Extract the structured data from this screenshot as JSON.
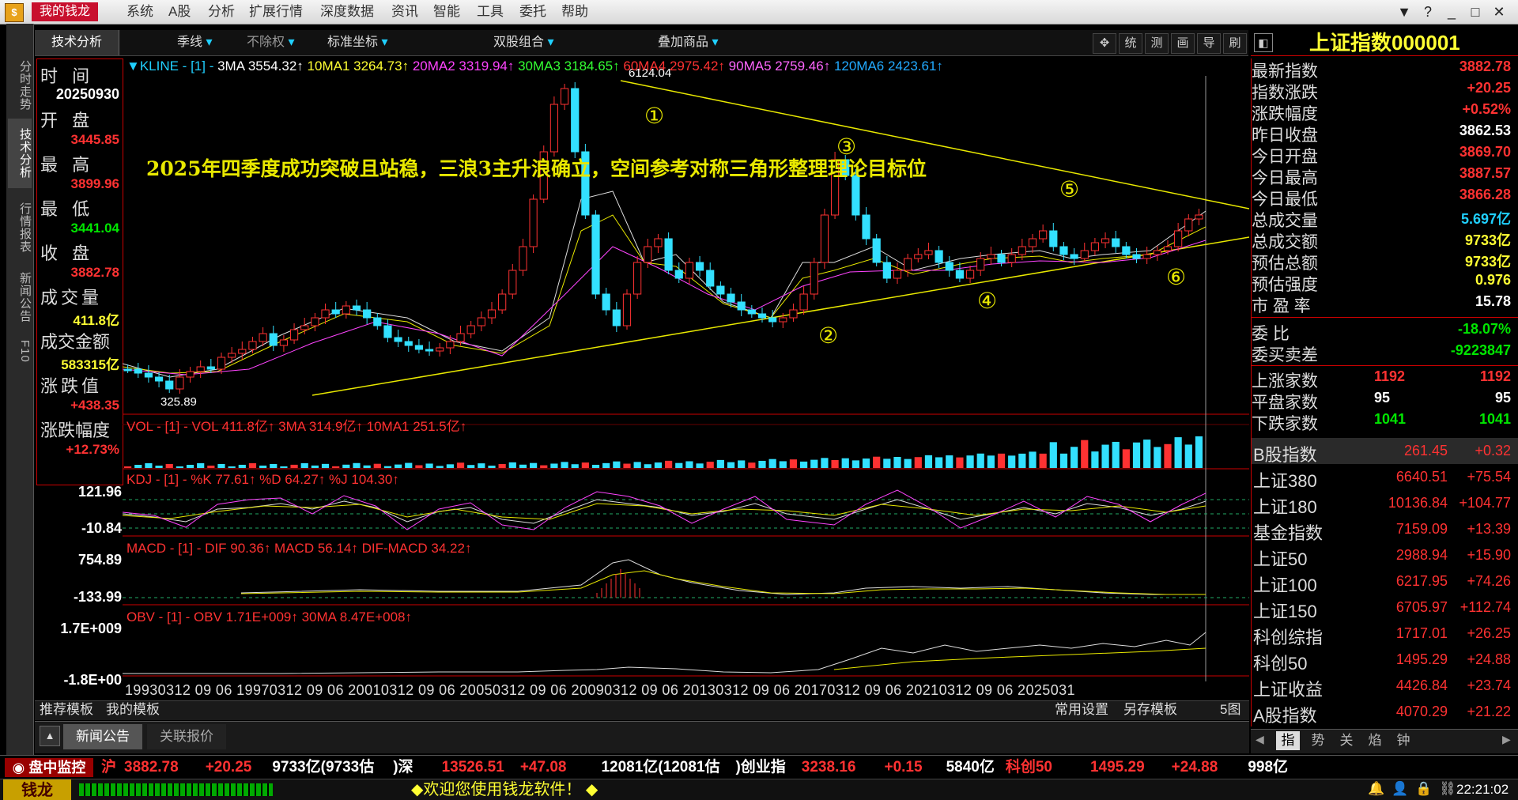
{
  "app": {
    "name": "我的钱龙",
    "menu": [
      "系统",
      "A股",
      "分析",
      "扩展行情",
      "深度数据",
      "资讯",
      "智能",
      "工具",
      "委托",
      "帮助"
    ],
    "window_buttons": [
      "▼",
      "?",
      "_",
      "□",
      "✕"
    ]
  },
  "left_tabs": [
    "分时走势",
    "技术分析",
    "行情报表",
    "新闻公告",
    "F10"
  ],
  "toolbar": {
    "tab_label": "技术分析",
    "period": "季线",
    "fq": "不除权",
    "coord": "标准坐标",
    "combo": "双股组合",
    "overlay": "叠加商品",
    "tool_icons": [
      "统",
      "测",
      "画",
      "导",
      "刷"
    ]
  },
  "info": {
    "time_label": "时  间",
    "time": "20250930",
    "open_label": "开  盘",
    "open": "3445.85",
    "high_label": "最  高",
    "high": "3899.96",
    "low_label": "最  低",
    "low": "3441.04",
    "close_label": "收  盘",
    "close": "3882.78",
    "vol_label": "成交量",
    "vol": "411.8亿",
    "amt_label": "成交金额",
    "amt": "583315亿",
    "chg_label": "涨跌值",
    "chg": "+438.35",
    "pct_label": "涨跌幅度",
    "pct": "+12.73%"
  },
  "chart_legends": {
    "kline": {
      "title": "▼KLINE - [1] -",
      "items": [
        {
          "text": "3MA 3554.32↑",
          "color": "#ffffff"
        },
        {
          "text": "10MA1 3264.73↑",
          "color": "#ffff33"
        },
        {
          "text": "20MA2 3319.94↑",
          "color": "#ff44ff"
        },
        {
          "text": "30MA3 3184.65↑",
          "color": "#33ff33"
        },
        {
          "text": "60MA4 2975.42↑",
          "color": "#ff3232"
        },
        {
          "text": "90MA5 2759.46↑",
          "color": "#ff66ff"
        },
        {
          "text": "120MA6 2423.61↑",
          "color": "#22aaff"
        }
      ]
    },
    "vol": "VOL - [1] - VOL 411.8亿↑ 3MA 314.9亿↑ 10MA1 251.5亿↑",
    "kdj": "KDJ - [1] - %K 77.61↑ %D 64.27↑ %J 104.30↑",
    "macd": "MACD - [1] - DIF 90.36↑ MACD 56.14↑ DIF-MACD 34.22↑",
    "obv": "OBV - [1] - OBV 1.71E+009↑ 30MA 8.47E+008↑"
  },
  "annotation": "2025年四季度成功突破且站稳，三浪3主升浪确立，空间参考对称三角形整理理论目标位",
  "markers": [
    "6124.04",
    "325.89",
    "①",
    "②",
    "③",
    "④",
    "⑤",
    "⑥"
  ],
  "axis_values": {
    "kdj_top": "121.96",
    "kdj_bot": "-10.84",
    "macd_top": "754.89",
    "macd_bot": "-133.99",
    "obv_top": "1.7E+009",
    "obv_bot": "-1.8E+00"
  },
  "x_axis": "19930312 09 06 19970312 09 06 20010312 09 06 20050312 09 06 20090312 09 06 20130312 09 06 20170312 09 06 20210312 09 06 2025031",
  "bottom_tabs": {
    "template_tabs": [
      "推荐模板",
      "我的模板"
    ],
    "right_controls": [
      "常用设置",
      "另存模板",
      "5图"
    ],
    "news_tabs": [
      "新闻公告",
      "关联报价"
    ]
  },
  "right_panel": {
    "title": "上证指数000001",
    "rows": [
      {
        "label": "最新指数",
        "value": "3882.78",
        "color": "#ff3232"
      },
      {
        "label": "指数涨跌",
        "value": "+20.25",
        "color": "#ff3232"
      },
      {
        "label": "涨跌幅度",
        "value": "+0.52%",
        "color": "#ff3232"
      },
      {
        "label": "昨日收盘",
        "value": "3862.53",
        "color": "#ffffff"
      },
      {
        "label": "今日开盘",
        "value": "3869.70",
        "color": "#ff3232"
      },
      {
        "label": "今日最高",
        "value": "3887.57",
        "color": "#ff3232"
      },
      {
        "label": "今日最低",
        "value": "3866.28",
        "color": "#ff3232"
      },
      {
        "label": "总成交量",
        "value": "5.697亿",
        "color": "#20d0ff"
      },
      {
        "label": "总成交额",
        "value": "9733亿",
        "color": "#ffff33"
      },
      {
        "label": "预估总额",
        "value": "9733亿",
        "color": "#ffff33"
      },
      {
        "label": "预估强度",
        "value": "0.976",
        "color": "#ffff33"
      },
      {
        "label": "市 盈 率",
        "value": "15.78",
        "color": "#ffffff"
      }
    ],
    "rows2": [
      {
        "label": "委  比",
        "value": "-18.07%",
        "color": "#00e600"
      },
      {
        "label": "委买卖差",
        "value": "-9223847",
        "color": "#00e600"
      }
    ],
    "breadth": [
      {
        "label": "上涨家数",
        "v1": "1192",
        "v2": "1192",
        "color": "#ff3232"
      },
      {
        "label": "平盘家数",
        "v1": "95",
        "v2": "95",
        "color": "#ffffff"
      },
      {
        "label": "下跌家数",
        "v1": "1041",
        "v2": "1041",
        "color": "#00e600"
      }
    ],
    "indices": [
      {
        "name": "B股指数",
        "price": "261.45",
        "chg": "+0.32"
      },
      {
        "name": "上证380",
        "price": "6640.51",
        "chg": "+75.54"
      },
      {
        "name": "上证180",
        "price": "10136.84",
        "chg": "+104.77"
      },
      {
        "name": "基金指数",
        "price": "7159.09",
        "chg": "+13.39"
      },
      {
        "name": "上证50",
        "price": "2988.94",
        "chg": "+15.90"
      },
      {
        "name": "上证100",
        "price": "6217.95",
        "chg": "+74.26"
      },
      {
        "name": "上证150",
        "price": "6705.97",
        "chg": "+112.74"
      },
      {
        "name": "科创综指",
        "price": "1717.01",
        "chg": "+26.25"
      },
      {
        "name": "科创50",
        "price": "1495.29",
        "chg": "+24.88"
      },
      {
        "name": "上证收益",
        "price": "4426.84",
        "chg": "+23.74"
      },
      {
        "name": "A股指数",
        "price": "4070.29",
        "chg": "+21.22"
      }
    ],
    "bottom_tabs": [
      "指",
      "势",
      "关",
      "焰",
      "钟"
    ]
  },
  "ticker": {
    "label": "盘中监控",
    "items": [
      {
        "text": "沪",
        "color": "#ff3232"
      },
      {
        "text": "3882.78",
        "color": "#ff3232"
      },
      {
        "text": "+20.25",
        "color": "#ff3232"
      },
      {
        "text": "9733亿(9733估",
        "color": "#ffffff"
      },
      {
        "text": ")深",
        "color": "#ffffff"
      },
      {
        "text": "13526.51",
        "color": "#ff3232"
      },
      {
        "text": "+47.08",
        "color": "#ff3232"
      },
      {
        "text": "12081亿(12081估",
        "color": "#ffffff"
      },
      {
        "text": ")创业指",
        "color": "#ffffff"
      },
      {
        "text": "3238.16",
        "color": "#ff3232"
      },
      {
        "text": "+0.15",
        "color": "#ff3232"
      },
      {
        "text": "5840亿",
        "color": "#ffffff"
      },
      {
        "text": "科创50",
        "color": "#ff3232"
      },
      {
        "text": "1495.29",
        "color": "#ff3232"
      },
      {
        "text": "+24.88",
        "color": "#ff3232"
      },
      {
        "text": "998亿",
        "color": "#ffffff"
      }
    ]
  },
  "status": {
    "logo": "钱龙",
    "message": "◆欢迎您使用钱龙软件！ ◆",
    "time": "22:21:02"
  },
  "chart_data": {
    "type": "candlestick",
    "period": "quarterly",
    "x_range": [
      "1993",
      "2025"
    ],
    "series": {
      "label_high": "6124.04",
      "label_low": "325.89",
      "last_close": 3882.78
    }
  }
}
